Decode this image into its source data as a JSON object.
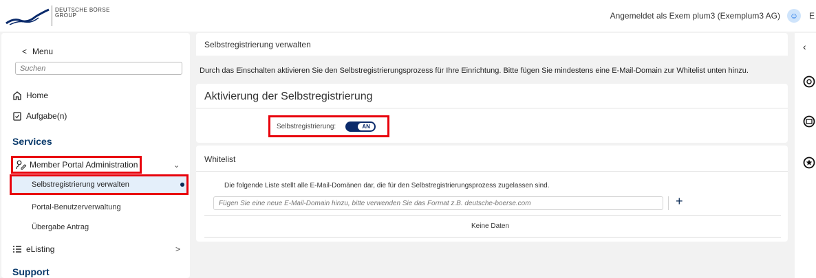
{
  "header": {
    "brand_line1": "DEUTSCHE BÖRSE",
    "brand_line2": "GROUP",
    "user_text": "Angemeldet als Exem plum3 (Exemplum3 AG)",
    "user_initial": "E"
  },
  "sidebar": {
    "back_label": "Menu",
    "search_placeholder": "Suchen",
    "home_label": "Home",
    "tasks_label": "Aufgabe(n)",
    "services_title": "Services",
    "mpa_label": "Member Portal Administration",
    "sub_items": [
      "Selbstregistrierung verwalten",
      "Portal-Benutzerverwaltung",
      "Übergabe Antrag"
    ],
    "elisting_label": "eListing",
    "support_title": "Support"
  },
  "main": {
    "page_title": "Selbstregistrierung verwalten",
    "description": "Durch das Einschalten aktivieren Sie den Selbstregistrierungsprozess für Ihre Einrichtung. Bitte fügen Sie mindestens eine E-Mail-Domain zur Whitelist unten hinzu.",
    "activation_title": "Aktivierung der Selbstregistrierung",
    "toggle_label": "Selbstregistrierung:",
    "toggle_state": "AN",
    "whitelist_title": "Whitelist",
    "whitelist_desc": "Die folgende Liste stellt alle E-Mail-Domänen dar, die für den Selbstregistrierungsprozess zugelassen sind.",
    "domain_placeholder": "Fügen Sie eine neue E-Mail-Domain hinzu, bitte verwenden Sie das Format z.B. deutsche-boerse.com",
    "add_label": "+",
    "no_data": "Keine Daten"
  },
  "rail": {
    "collapse_label": "‹"
  }
}
